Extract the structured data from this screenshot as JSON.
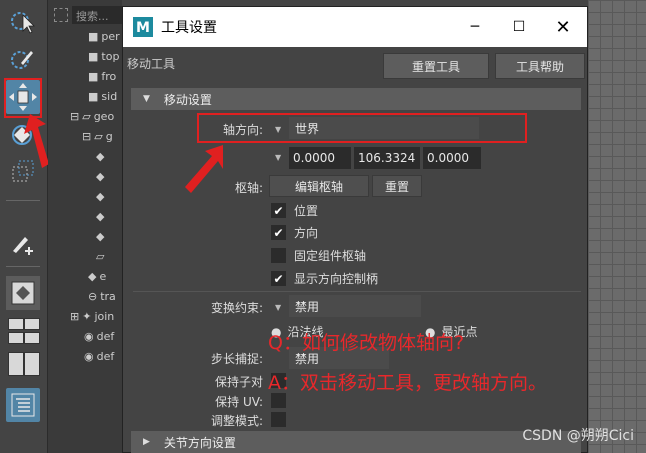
{
  "outliner": {
    "search_placeholder": "搜索...",
    "items": [
      {
        "label": "per",
        "icon": "camera-icon"
      },
      {
        "label": "top",
        "icon": "camera-icon"
      },
      {
        "label": "fro",
        "icon": "camera-icon"
      },
      {
        "label": "sid",
        "icon": "camera-icon"
      },
      {
        "label": "geo",
        "icon": "group-icon"
      },
      {
        "label": "g",
        "icon": "group-icon"
      },
      {
        "label": "e",
        "icon": "mesh-icon"
      },
      {
        "label": "tra",
        "icon": "curve-icon"
      },
      {
        "label": "join",
        "icon": "joint-icon"
      },
      {
        "label": "def",
        "icon": "set-icon"
      },
      {
        "label": "def",
        "icon": "set-icon"
      }
    ]
  },
  "dialog": {
    "title": "工具设置",
    "tool_name": "移动工具",
    "reset_tool_label": "重置工具",
    "tool_help_label": "工具帮助",
    "section_move_settings": "移动设置",
    "axis_orientation_label": "轴方向:",
    "axis_orientation_value": "世界",
    "coords": [
      "0.0000",
      "106.3324",
      "0.0000"
    ],
    "pivot_label": "枢轴:",
    "edit_pivot_label": "编辑枢轴",
    "reset_label": "重置",
    "checks": [
      {
        "label": "位置",
        "checked": true
      },
      {
        "label": "方向",
        "checked": true
      },
      {
        "label": "固定组件枢轴",
        "checked": false
      },
      {
        "label": "显示方向控制柄",
        "checked": true
      }
    ],
    "transform_constraint_label": "变换约束:",
    "transform_constraint_value": "禁用",
    "along_normal_label": "沿法线",
    "closest_point_label": "最近点",
    "step_snap_label": "步长捕捉:",
    "step_snap_value": "禁用",
    "preserve_children_label": "保持子对",
    "preserve_uv_label": "保持 UV:",
    "tweak_mode_label": "调整模式:",
    "section_joint_orient": "关节方向设置"
  },
  "annotation": {
    "question": "Q：如何修改物体轴向?",
    "answer": "A：双击移动工具，更改轴方向。",
    "accent_color": "#e8282b"
  },
  "watermark": "CSDN @朔朔Cici"
}
